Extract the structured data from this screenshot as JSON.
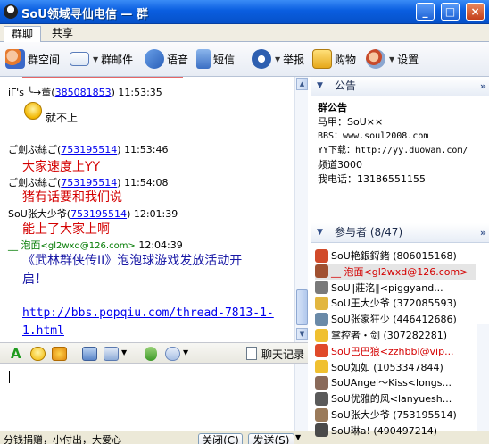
{
  "window": {
    "title": "SoU领域寻仙电信 — 群",
    "controls": [
      "_",
      "□",
      "×"
    ]
  },
  "tabs": [
    {
      "label": "群聊"
    },
    {
      "label": "共享"
    }
  ],
  "toolbar": {
    "group_space": "群空间",
    "group_mail": "群邮件",
    "voice": "语音",
    "sms": "短信",
    "report": "举报",
    "shop": "购物",
    "settings": "设置"
  },
  "chat": {
    "partial_top_header": "iΓ's ╰→董(385081853) 11:53:35",
    "partial_top_uid_text": "iΓ's ╰→董",
    "partial_top_uid": "385081853",
    "partial_top_time": "11:53:35",
    "messages": [
      {
        "body": "就不上"
      },
      {
        "sender": "ご劍ぷ絲ご",
        "uid": "753195514",
        "time": "11:53:46",
        "body": "大家速度上YY"
      },
      {
        "sender": "ご劍ぷ絲ご",
        "uid": "753195514",
        "time": "11:54:08",
        "body": "猪有话要和我们说"
      },
      {
        "sender": "SoU张大少爷",
        "uid": "753195514",
        "time": "12:01:39",
        "body": "能上了大家上啊"
      },
      {
        "sender": "__ 泡面",
        "email": "<gl2wxd@126.com>",
        "time": "12:04:39",
        "body_line1": "《武林群侠传II》泡泡球游戏发放活动开",
        "body_line2": "启！",
        "link_line1": "http://bbs.popqiu.com/thread-7813-1-",
        "link_line2": "1.html"
      }
    ]
  },
  "input_toolbar": {
    "history": "聊天记录"
  },
  "bottom": {
    "marquee": "分钱捐赠，小付出，大爱心",
    "close": "关闭(C)",
    "send": "发送(S)"
  },
  "announcement": {
    "header": "公告",
    "title": "群公告",
    "lines": [
      "马甲：SoU××",
      "BBS：www.soul2008.com",
      "YY下载：http://yy.duowan.com/",
      "频道3000",
      "我电话：13186551155"
    ]
  },
  "members": {
    "header": "参与者 (8/47)",
    "list": [
      {
        "name": "SoU艳銀鋝鍺 (806015168)",
        "color": "#000000",
        "avatar": "#d14a2a"
      },
      {
        "name": "__ 泡面<gl2wxd@126.com>",
        "color": "#d40000",
        "avatar": "#a05030"
      },
      {
        "name": "SoU‖莊洺‖<piggyand...",
        "color": "#000000",
        "avatar": "#7a7a7a"
      },
      {
        "name": "SoU王大少爷 (372085593)",
        "color": "#000000",
        "avatar": "#e2b640"
      },
      {
        "name": "SoU张家狂少 (446412686)",
        "color": "#000000",
        "avatar": "#6a8aa8"
      },
      {
        "name": "掌控者・剑 (307282281)",
        "color": "#000000",
        "avatar": "#f0c030"
      },
      {
        "name": "SoU巴巴狼<zzhbbl@vip...",
        "color": "#d40000",
        "avatar": "#e04a2a"
      },
      {
        "name": "SoU如如 (1053347844)",
        "color": "#000000",
        "avatar": "#f0c030"
      },
      {
        "name": "SoUAngel〜Kiss<longs...",
        "color": "#000000",
        "avatar": "#8a6a5a"
      },
      {
        "name": "SoU优雅的风<lanyuesh...",
        "color": "#000000",
        "avatar": "#5a5a5a"
      },
      {
        "name": "SoU张大少爷 (753195514)",
        "color": "#000000",
        "avatar": "#9a7a5a"
      },
      {
        "name": "SoU琳a! (490497214)",
        "color": "#000000",
        "avatar": "#4a4a4a"
      }
    ]
  },
  "colors": {
    "titlebar": "#0a5ee0",
    "sender_name": "#c00000",
    "message_red": "#d40000",
    "message_blue": "#1a1aa6",
    "link": "#0000ee",
    "time": "#000000"
  }
}
